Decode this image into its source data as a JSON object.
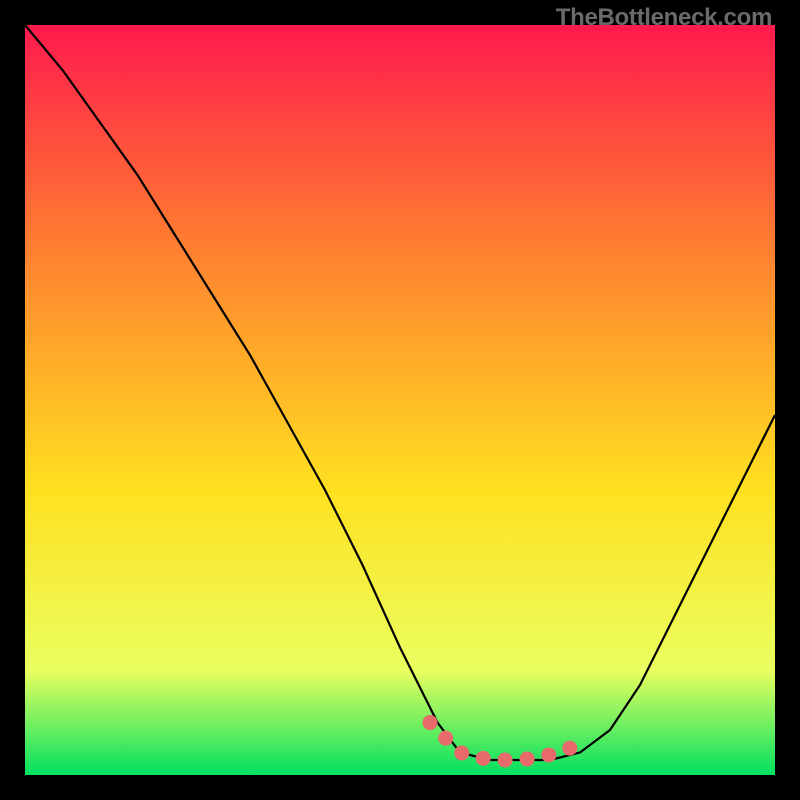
{
  "watermark": "TheBottleneck.com",
  "colors": {
    "background": "#000000",
    "gradient_top": "#ff1a4d",
    "gradient_mid1": "#ff8030",
    "gradient_mid2": "#ffe020",
    "gradient_low": "#eaff60",
    "gradient_bottom": "#00e060",
    "curve": "#000000",
    "marker": "#e86a6a"
  },
  "chart_data": {
    "type": "line",
    "title": "",
    "xlabel": "",
    "ylabel": "",
    "xlim": [
      0,
      100
    ],
    "ylim": [
      0,
      100
    ],
    "series": [
      {
        "name": "bottleneck-curve",
        "x": [
          0,
          5,
          10,
          15,
          20,
          25,
          30,
          35,
          40,
          45,
          50,
          55,
          58,
          62,
          66,
          70,
          74,
          78,
          82,
          86,
          90,
          94,
          98,
          100
        ],
        "values": [
          100,
          94,
          87,
          80,
          72,
          64,
          56,
          47,
          38,
          28,
          17,
          7,
          3,
          2,
          2,
          2,
          3,
          6,
          12,
          20,
          28,
          36,
          44,
          48
        ]
      }
    ],
    "markers": {
      "name": "highlight-range",
      "x": [
        54,
        56,
        58,
        60,
        62,
        64,
        66,
        68,
        70,
        72,
        74
      ],
      "values": [
        7,
        5,
        3,
        2.5,
        2,
        2,
        2,
        2.3,
        2.7,
        3.3,
        4.2
      ]
    }
  }
}
